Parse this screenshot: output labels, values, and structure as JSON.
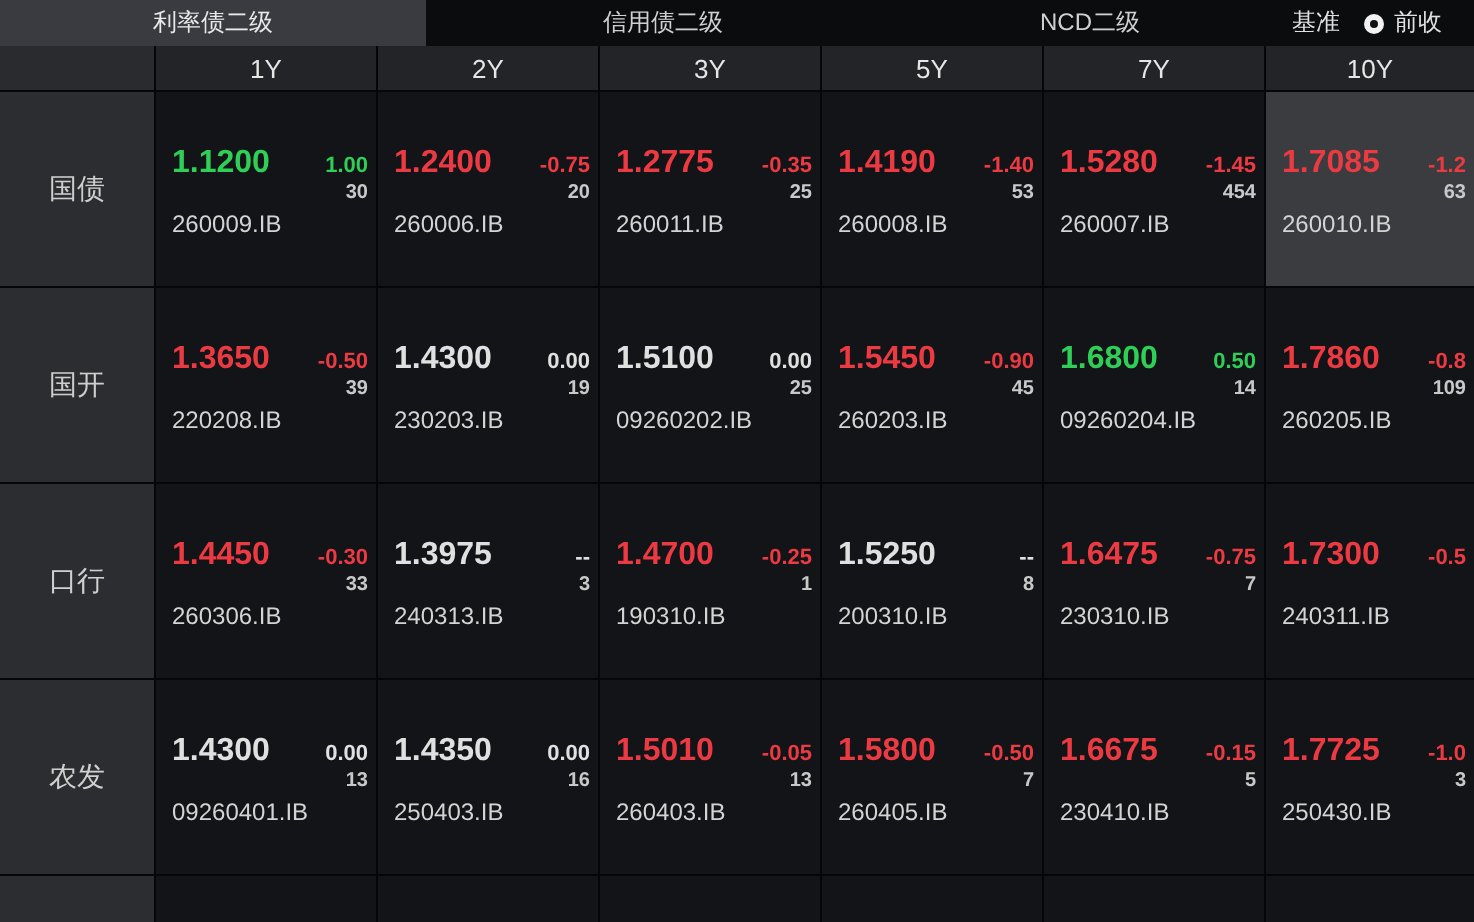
{
  "tabs": [
    {
      "label": "利率债二级",
      "selected": true
    },
    {
      "label": "信用债二级",
      "selected": false
    },
    {
      "label": "NCD二级",
      "selected": false
    }
  ],
  "basis": {
    "label": "基准",
    "option": "前收",
    "selected": true
  },
  "columns": [
    "1Y",
    "2Y",
    "3Y",
    "5Y",
    "7Y",
    "10Y"
  ],
  "rows": [
    {
      "name": "国债",
      "cells": [
        {
          "yield": "1.1200",
          "change": "1.00",
          "count": "30",
          "code": "260009.IB",
          "color": "#2fce57",
          "selected": false
        },
        {
          "yield": "1.2400",
          "change": "-0.75",
          "count": "20",
          "code": "260006.IB",
          "color": "#ec3a43",
          "selected": false
        },
        {
          "yield": "1.2775",
          "change": "-0.35",
          "count": "25",
          "code": "260011.IB",
          "color": "#ec3a43",
          "selected": false
        },
        {
          "yield": "1.4190",
          "change": "-1.40",
          "count": "53",
          "code": "260008.IB",
          "color": "#ec3a43",
          "selected": false
        },
        {
          "yield": "1.5280",
          "change": "-1.45",
          "count": "454",
          "code": "260007.IB",
          "color": "#ec3a43",
          "selected": false
        },
        {
          "yield": "1.7085",
          "change": "-1.2",
          "count": "63",
          "code": "260010.IB",
          "color": "#ec3a43",
          "selected": true
        }
      ]
    },
    {
      "name": "国开",
      "cells": [
        {
          "yield": "1.3650",
          "change": "-0.50",
          "count": "39",
          "code": "220208.IB",
          "color": "#ec3a43",
          "selected": false
        },
        {
          "yield": "1.4300",
          "change": "0.00",
          "count": "19",
          "code": "230203.IB",
          "color": "#e0e0e0",
          "selected": false
        },
        {
          "yield": "1.5100",
          "change": "0.00",
          "count": "25",
          "code": "09260202.IB",
          "color": "#e0e0e0",
          "selected": false
        },
        {
          "yield": "1.5450",
          "change": "-0.90",
          "count": "45",
          "code": "260203.IB",
          "color": "#ec3a43",
          "selected": false
        },
        {
          "yield": "1.6800",
          "change": "0.50",
          "count": "14",
          "code": "09260204.IB",
          "color": "#2fce57",
          "selected": false
        },
        {
          "yield": "1.7860",
          "change": "-0.8",
          "count": "109",
          "code": "260205.IB",
          "color": "#ec3a43",
          "selected": false
        }
      ]
    },
    {
      "name": "口行",
      "cells": [
        {
          "yield": "1.4450",
          "change": "-0.30",
          "count": "33",
          "code": "260306.IB",
          "color": "#ec3a43",
          "selected": false
        },
        {
          "yield": "1.3975",
          "change": "--",
          "count": "3",
          "code": "240313.IB",
          "color": "#e0e0e0",
          "selected": false
        },
        {
          "yield": "1.4700",
          "change": "-0.25",
          "count": "1",
          "code": "190310.IB",
          "color": "#ec3a43",
          "selected": false
        },
        {
          "yield": "1.5250",
          "change": "--",
          "count": "8",
          "code": "200310.IB",
          "color": "#e0e0e0",
          "selected": false
        },
        {
          "yield": "1.6475",
          "change": "-0.75",
          "count": "7",
          "code": "230310.IB",
          "color": "#ec3a43",
          "selected": false
        },
        {
          "yield": "1.7300",
          "change": "-0.5",
          "code": "240311.IB",
          "color": "#ec3a43",
          "selected": false
        }
      ]
    },
    {
      "name": "农发",
      "cells": [
        {
          "yield": "1.4300",
          "change": "0.00",
          "count": "13",
          "code": "09260401.IB",
          "color": "#e0e0e0",
          "selected": false
        },
        {
          "yield": "1.4350",
          "change": "0.00",
          "count": "16",
          "code": "250403.IB",
          "color": "#e0e0e0",
          "selected": false
        },
        {
          "yield": "1.5010",
          "change": "-0.05",
          "count": "13",
          "code": "260403.IB",
          "color": "#ec3a43",
          "selected": false
        },
        {
          "yield": "1.5800",
          "change": "-0.50",
          "count": "7",
          "code": "260405.IB",
          "color": "#ec3a43",
          "selected": false
        },
        {
          "yield": "1.6675",
          "change": "-0.15",
          "count": "5",
          "code": "230410.IB",
          "color": "#ec3a43",
          "selected": false
        },
        {
          "yield": "1.7725",
          "change": "-1.0",
          "count": "3",
          "code": "250430.IB",
          "color": "#ec3a43",
          "selected": false
        }
      ]
    }
  ]
}
